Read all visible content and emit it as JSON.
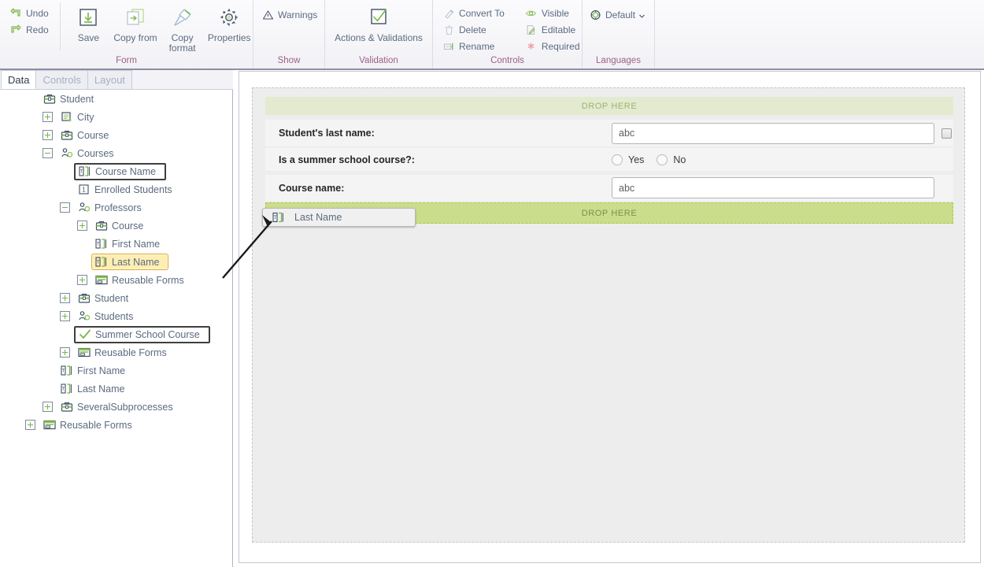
{
  "ribbon": {
    "groups": [
      {
        "name": "form",
        "title": "Form",
        "small_commands": [
          {
            "label": "Undo",
            "icon": "undo-icon"
          },
          {
            "label": "Redo",
            "icon": "redo-icon"
          }
        ],
        "big_commands": [
          {
            "label": "Save",
            "icon": "save-icon"
          },
          {
            "label": "Copy from",
            "icon": "copy-from-icon"
          },
          {
            "label": "Copy format",
            "icon": "copy-format-icon"
          },
          {
            "label": "Properties",
            "icon": "gear-icon"
          }
        ]
      },
      {
        "name": "show",
        "title": "Show",
        "small_commands": [
          {
            "label": "Warnings",
            "icon": "warning-triangle-icon"
          }
        ],
        "big_commands": []
      },
      {
        "name": "validation",
        "title": "Validation",
        "small_commands": [],
        "big_commands": [
          {
            "label": "Actions & Validations",
            "icon": "checkmark-box-icon"
          }
        ]
      },
      {
        "name": "controls",
        "title": "Controls",
        "small_commands": [
          {
            "label": "Convert To",
            "icon": "convert-to-icon"
          },
          {
            "label": "Delete",
            "icon": "trash-icon"
          },
          {
            "label": "Rename",
            "icon": "rename-icon"
          }
        ],
        "small_commands2": [
          {
            "label": "Visible",
            "icon": "eye-icon"
          },
          {
            "label": "Editable",
            "icon": "pencil-page-icon"
          },
          {
            "label": "Required",
            "icon": "asterisk-icon"
          }
        ],
        "big_commands": []
      },
      {
        "name": "languages",
        "title": "Languages",
        "small_commands": [
          {
            "label": "Default",
            "icon": "globe-icon",
            "has_dropdown": true
          }
        ],
        "big_commands": []
      }
    ]
  },
  "left_panel": {
    "tabs": [
      {
        "label": "Data",
        "active": true
      },
      {
        "label": "Controls",
        "active": false
      },
      {
        "label": "Layout",
        "active": false
      }
    ],
    "tree": [
      {
        "label": "Student",
        "depth": 0,
        "expander": "none",
        "icon": "briefcase-icon",
        "state": "normal"
      },
      {
        "label": "City",
        "depth": 1,
        "expander": "plus",
        "icon": "document-add-icon",
        "state": "normal"
      },
      {
        "label": "Course",
        "depth": 1,
        "expander": "plus",
        "icon": "briefcase-icon",
        "state": "normal"
      },
      {
        "label": "Courses",
        "depth": 1,
        "expander": "minus",
        "icon": "collection-icon",
        "state": "normal"
      },
      {
        "label": "Course Name",
        "depth": 2,
        "expander": "none",
        "icon": "text-field-icon",
        "state": "boxed"
      },
      {
        "label": "Enrolled Students",
        "depth": 2,
        "expander": "none",
        "icon": "number-field-icon",
        "state": "normal"
      },
      {
        "label": "Professors",
        "depth": 2,
        "expander": "minus",
        "icon": "collection-icon",
        "state": "normal"
      },
      {
        "label": "Course",
        "depth": 3,
        "expander": "plus",
        "icon": "briefcase-icon",
        "state": "normal"
      },
      {
        "label": "First Name",
        "depth": 3,
        "expander": "none",
        "icon": "text-field-icon",
        "state": "normal"
      },
      {
        "label": "Last Name",
        "depth": 3,
        "expander": "none",
        "icon": "text-field-icon",
        "state": "selected"
      },
      {
        "label": "Reusable Forms",
        "depth": 3,
        "expander": "plus",
        "icon": "form-icon",
        "state": "normal"
      },
      {
        "label": "Student",
        "depth": 2,
        "expander": "plus",
        "icon": "briefcase-icon",
        "state": "normal"
      },
      {
        "label": "Students",
        "depth": 2,
        "expander": "plus",
        "icon": "collection-icon",
        "state": "normal"
      },
      {
        "label": "Summer School Course",
        "depth": 2,
        "expander": "none",
        "icon": "checkmark-icon",
        "state": "boxed"
      },
      {
        "label": "Reusable Forms",
        "depth": 2,
        "expander": "plus",
        "icon": "form-icon",
        "state": "normal"
      },
      {
        "label": "First Name",
        "depth": 1,
        "expander": "none",
        "icon": "text-field-icon",
        "state": "normal"
      },
      {
        "label": "Last Name",
        "depth": 1,
        "expander": "none",
        "icon": "text-field-icon",
        "state": "normal"
      },
      {
        "label": "SeveralSubprocesses",
        "depth": 1,
        "expander": "plus",
        "icon": "briefcase-icon",
        "state": "normal"
      },
      {
        "label": "Reusable Forms",
        "depth": 0,
        "expander": "plus",
        "icon": "form-icon",
        "state": "normal"
      }
    ]
  },
  "designer": {
    "drop_top_label": "DROP HERE",
    "drop_bottom_label": "DROP HERE",
    "rows": [
      {
        "label": "Student's last name:",
        "control": "textbox",
        "value": "abc",
        "has_checkbox": true
      },
      {
        "label": "Is a summer school course?:",
        "control": "radio",
        "options": [
          "Yes",
          "No"
        ]
      },
      {
        "label": "Course name:",
        "control": "textbox",
        "value": "abc",
        "has_checkbox": false
      }
    ]
  },
  "drag_ghost": {
    "label": "Last Name",
    "icon": "text-field-icon"
  },
  "colors": {
    "accent_green": "#7ab648",
    "drop_band_light": "#e3ead0",
    "drop_band_active": "#cadd8d",
    "selection_yellow": "#ffeeb4",
    "group_title": "#9c5f87",
    "text_blue": "#5b6b80"
  }
}
